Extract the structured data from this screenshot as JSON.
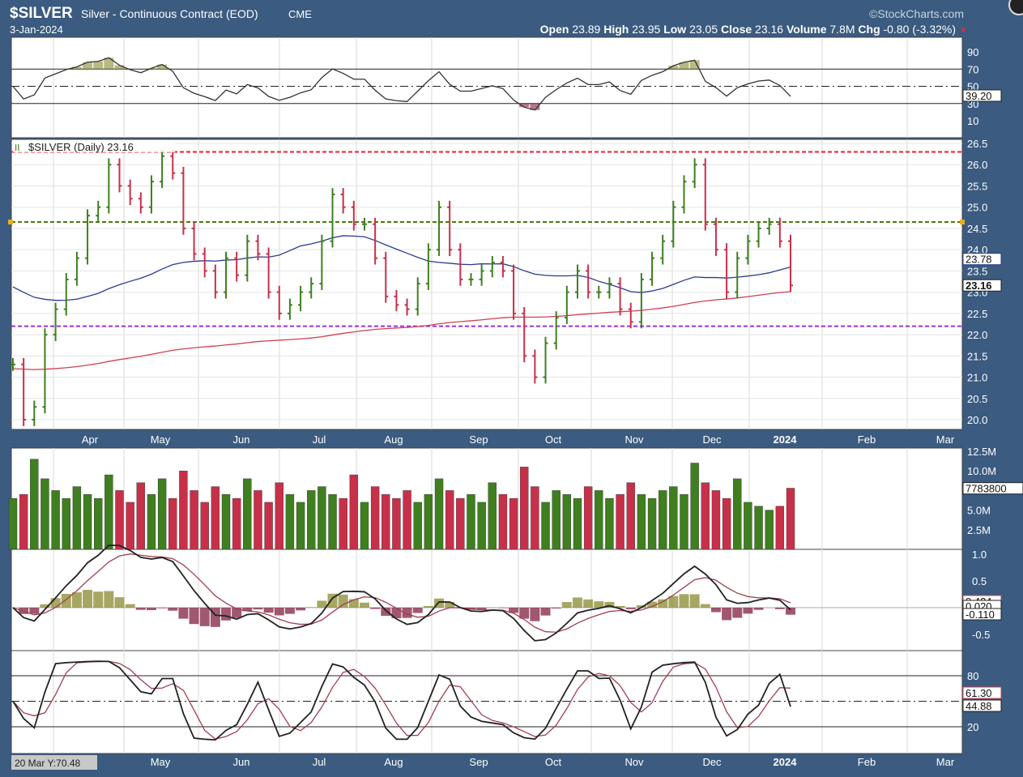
{
  "header": {
    "symbol": "$SILVER",
    "name": "Silver - Continuous Contract (EOD)",
    "exchange": "CME",
    "brand": "©StockCharts.com",
    "date": "3-Jan-2024",
    "open_label": "Open",
    "open": "23.89",
    "high_label": "High",
    "high": "23.95",
    "low_label": "Low",
    "low": "23.05",
    "close_label": "Close",
    "close": "23.16",
    "volume_label": "Volume",
    "volume": "7.8M",
    "chg_label": "Chg",
    "chg": "-0.80 (-3.32%)"
  },
  "price_legend": "$SILVER (Daily) 23.16",
  "readouts": {
    "rsi": "39.20",
    "ma": "23.78",
    "price": "23.16",
    "volume": "7783800",
    "macd_a": "0.424",
    "macd_b": "0.020",
    "macd_c": "-0.110",
    "stoch_a": "61.30",
    "stoch_b": "44.88",
    "crosshair": "20 Mar Y:70.48"
  },
  "colors": {
    "up": "#3f7f1f",
    "down": "#c8304a",
    "ma50": "#2b3b8f",
    "ma200": "#d04050",
    "frame": "#3b5b80"
  },
  "chart_data": {
    "type": "ohlc",
    "title": "$SILVER Silver - Continuous Contract (EOD)",
    "xlabel": "",
    "ylabel": "",
    "ylim": [
      20.0,
      26.5
    ],
    "x_range": [
      "2023-03-16",
      "2024-01-03"
    ],
    "month_labels": [
      "Apr",
      "May",
      "Jun",
      "Jul",
      "Aug",
      "Sep",
      "Oct",
      "Nov",
      "Dec",
      "2024",
      "Feb",
      "Mar"
    ],
    "price_ticks": [
      "26.5",
      "26.0",
      "25.5",
      "25.0",
      "24.5",
      "24.0",
      "23.5",
      "23.0",
      "22.5",
      "22.0",
      "21.5",
      "21.0",
      "20.5",
      "20.0"
    ],
    "rsi_ticks": [
      "90",
      "70",
      "50",
      "30",
      "10"
    ],
    "volume_ticks": [
      "12.5M",
      "10.0M",
      "5.0M",
      "2.5M"
    ],
    "macd_ticks": [
      "1.0",
      "0.5",
      "-0.5"
    ],
    "stoch_ticks": [
      "80",
      "20"
    ],
    "levels": [
      {
        "value": 26.3,
        "color": "#e8202a"
      },
      {
        "value": 24.65,
        "color": "#4a7a10"
      },
      {
        "value": 22.2,
        "color": "#9a30e0"
      }
    ],
    "closes": [
      21.3,
      20.0,
      20.3,
      22.0,
      22.6,
      23.3,
      23.8,
      24.8,
      25.0,
      26.0,
      25.5,
      25.2,
      25.0,
      25.6,
      26.2,
      25.8,
      24.5,
      23.9,
      23.5,
      23.0,
      23.8,
      23.4,
      24.2,
      23.9,
      23.0,
      22.5,
      22.7,
      23.0,
      23.2,
      24.2,
      25.3,
      25.0,
      24.6,
      24.6,
      23.8,
      22.9,
      22.7,
      22.6,
      23.2,
      24.0,
      25.0,
      24.0,
      23.3,
      23.3,
      23.5,
      23.7,
      23.5,
      22.5,
      21.5,
      21.0,
      21.8,
      22.4,
      23.0,
      23.5,
      23.0,
      23.0,
      23.2,
      22.6,
      22.3,
      23.3,
      23.8,
      24.2,
      25.0,
      25.6,
      26.0,
      24.6,
      24.0,
      23.0,
      23.8,
      24.2,
      24.5,
      24.6,
      24.2,
      23.16
    ],
    "volumes_m": [
      6.5,
      7.0,
      11.5,
      9.0,
      7.5,
      6.5,
      8.0,
      7.0,
      6.5,
      9.5,
      7.5,
      6.0,
      8.5,
      7.0,
      9.0,
      6.5,
      10.0,
      7.5,
      6.0,
      8.0,
      7.0,
      6.5,
      9.0,
      7.5,
      6.0,
      8.5,
      7.0,
      6.0,
      7.5,
      8.0,
      7.0,
      6.5,
      9.5,
      6.0,
      8.0,
      7.0,
      6.5,
      7.5,
      6.0,
      7.0,
      9.0,
      7.5,
      6.5,
      7.0,
      6.0,
      8.5,
      7.0,
      6.5,
      10.5,
      8.0,
      6.0,
      7.5,
      7.0,
      6.5,
      8.0,
      7.5,
      6.5,
      7.0,
      8.5,
      7.0,
      6.5,
      7.5,
      8.0,
      7.0,
      11.0,
      8.5,
      7.5,
      6.5,
      9.0,
      6.0,
      5.5,
      5.0,
      5.5,
      7.8
    ]
  }
}
